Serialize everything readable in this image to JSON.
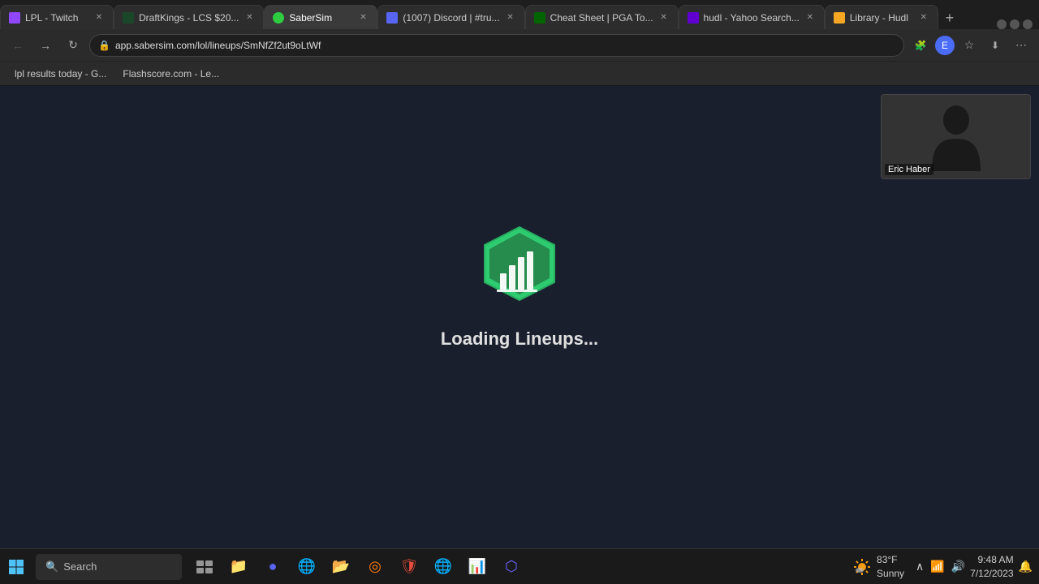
{
  "browser": {
    "tabs": [
      {
        "id": "lpl-twitch",
        "label": "LPL - Twitch",
        "favicon_type": "twitch",
        "active": false,
        "closable": true
      },
      {
        "id": "draftkings",
        "label": "DraftKings - LCS $20...",
        "favicon_type": "dk",
        "active": false,
        "closable": true
      },
      {
        "id": "sabersim",
        "label": "SaberSim",
        "favicon_type": "saber",
        "active": true,
        "closable": true
      },
      {
        "id": "discord",
        "label": "(1007) Discord | #tru...",
        "favicon_type": "discord",
        "active": false,
        "closable": true
      },
      {
        "id": "pga",
        "label": "Cheat Sheet | PGA To...",
        "favicon_type": "pga",
        "active": false,
        "closable": true
      },
      {
        "id": "yahoo",
        "label": "hudl - Yahoo Search...",
        "favicon_type": "yahoo",
        "active": false,
        "closable": true
      },
      {
        "id": "hudl",
        "label": "Library - Hudl",
        "favicon_type": "hudl",
        "active": false,
        "closable": true
      }
    ],
    "url": "app.sabersim.com/lol/lineups/SmNfZf2ut9oLtWf",
    "bookmarks": [
      {
        "label": "lpl results today - G..."
      },
      {
        "label": "Flashscore.com - Le..."
      }
    ]
  },
  "page": {
    "loading_text": "Loading Lineups...",
    "video_label": "Eric Haber"
  },
  "taskbar": {
    "search_placeholder": "Search",
    "time": "9:48 AM",
    "date": "7/12/2023",
    "weather_temp": "83°F",
    "weather_condition": "Sunny"
  }
}
